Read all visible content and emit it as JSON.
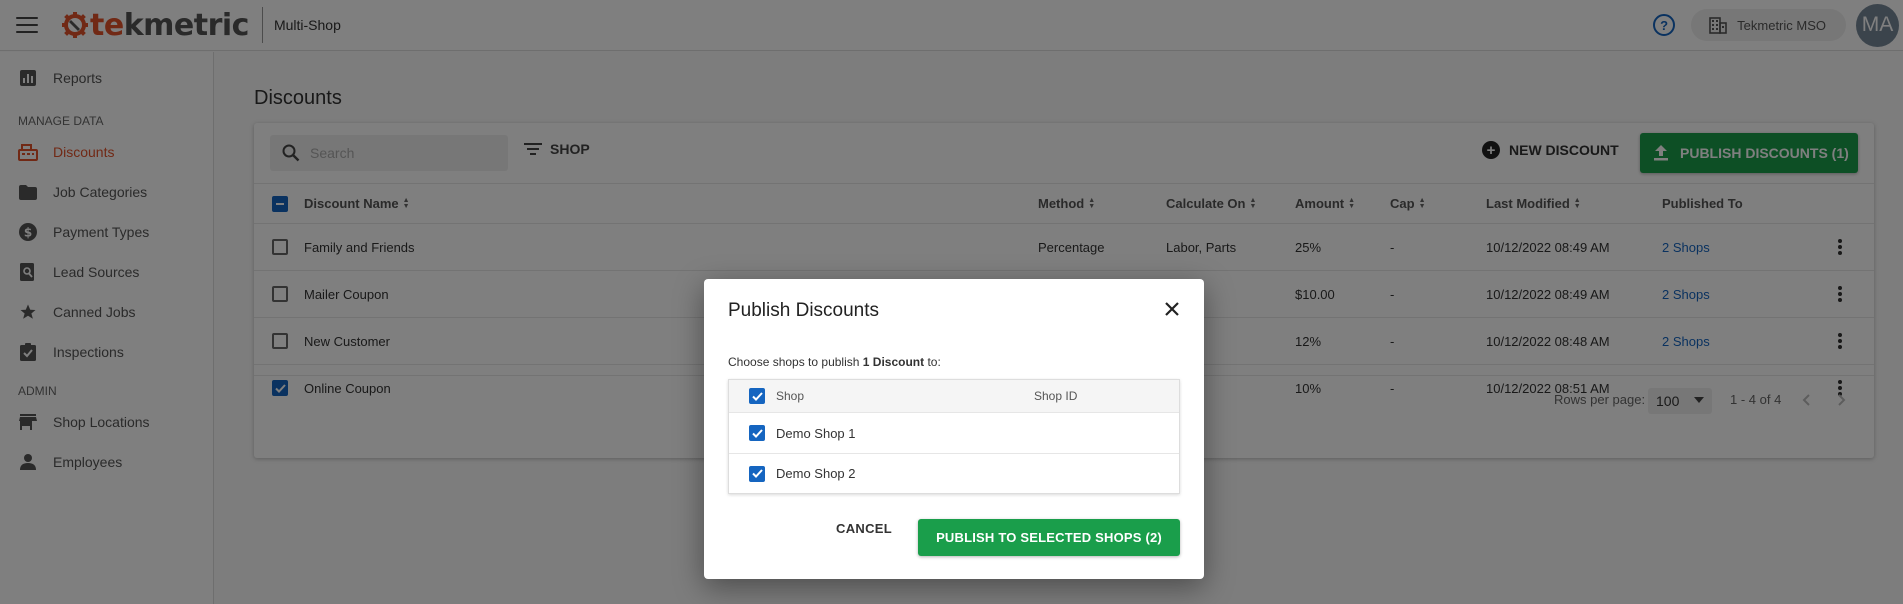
{
  "topbar": {
    "logo_accent": "te",
    "logo_rest": "kmetric",
    "app_name": "Multi-Shop",
    "org_name": "Tekmetric MSO",
    "avatar_initials": "MA",
    "help_glyph": "?"
  },
  "sidebar": {
    "items_top": [
      {
        "label": "Reports",
        "icon": "bar-chart-icon"
      }
    ],
    "manage_heading": "MANAGE DATA",
    "manage_items": [
      {
        "label": "Discounts",
        "icon": "cash-register-icon",
        "active": true
      },
      {
        "label": "Job Categories",
        "icon": "folder-icon"
      },
      {
        "label": "Payment Types",
        "icon": "dollar-circle-icon"
      },
      {
        "label": "Lead Sources",
        "icon": "search-document-icon"
      },
      {
        "label": "Canned Jobs",
        "icon": "star-icon"
      },
      {
        "label": "Inspections",
        "icon": "clipboard-check-icon"
      }
    ],
    "admin_heading": "ADMIN",
    "admin_items": [
      {
        "label": "Shop Locations",
        "icon": "store-icon"
      },
      {
        "label": "Employees",
        "icon": "person-icon"
      }
    ]
  },
  "main": {
    "title": "Discounts",
    "search_placeholder": "Search",
    "filter_label": "SHOP",
    "new_button": "NEW DISCOUNT",
    "publish_button": "PUBLISH DISCOUNTS (1)",
    "columns": [
      "Discount Name",
      "Method",
      "Calculate On",
      "Amount",
      "Cap",
      "Last Modified",
      "Published To"
    ],
    "rows": [
      {
        "name": "Family and Friends",
        "method": "Percentage",
        "calc": "Labor, Parts",
        "amount": "25%",
        "cap": "-",
        "modified": "10/12/2022 08:49 AM",
        "published": "2 Shops",
        "checked": false
      },
      {
        "name": "Mailer Coupon",
        "method": "",
        "calc": "",
        "amount": "$10.00",
        "cap": "-",
        "modified": "10/12/2022 08:49 AM",
        "published": "2 Shops",
        "checked": false
      },
      {
        "name": "New Customer",
        "method": "",
        "calc": "",
        "amount": "12%",
        "cap": "-",
        "modified": "10/12/2022 08:48 AM",
        "published": "2 Shops",
        "checked": false
      },
      {
        "name": "Online Coupon",
        "method": "",
        "calc": "",
        "amount": "10%",
        "cap": "-",
        "modified": "10/12/2022 08:51 AM",
        "published": "-",
        "checked": true
      }
    ],
    "rows_per_page_label": "Rows per page:",
    "rows_per_page_value": "100",
    "range": "1 - 4 of 4"
  },
  "dialog": {
    "title": "Publish Discounts",
    "desc_prefix": "Choose shops to publish",
    "desc_bold": "1 Discount",
    "desc_suffix": "to:",
    "col_shop": "Shop",
    "col_shop_id": "Shop ID",
    "shops": [
      {
        "name": "Demo Shop 1",
        "id": "",
        "checked": true
      },
      {
        "name": "Demo Shop 2",
        "id": "",
        "checked": true
      }
    ],
    "cancel": "CANCEL",
    "confirm": "PUBLISH TO SELECTED SHOPS (2)"
  },
  "colors": {
    "brand_orange": "#e2522b",
    "primary_green": "#1a9e4b",
    "link_blue": "#1565c0"
  }
}
